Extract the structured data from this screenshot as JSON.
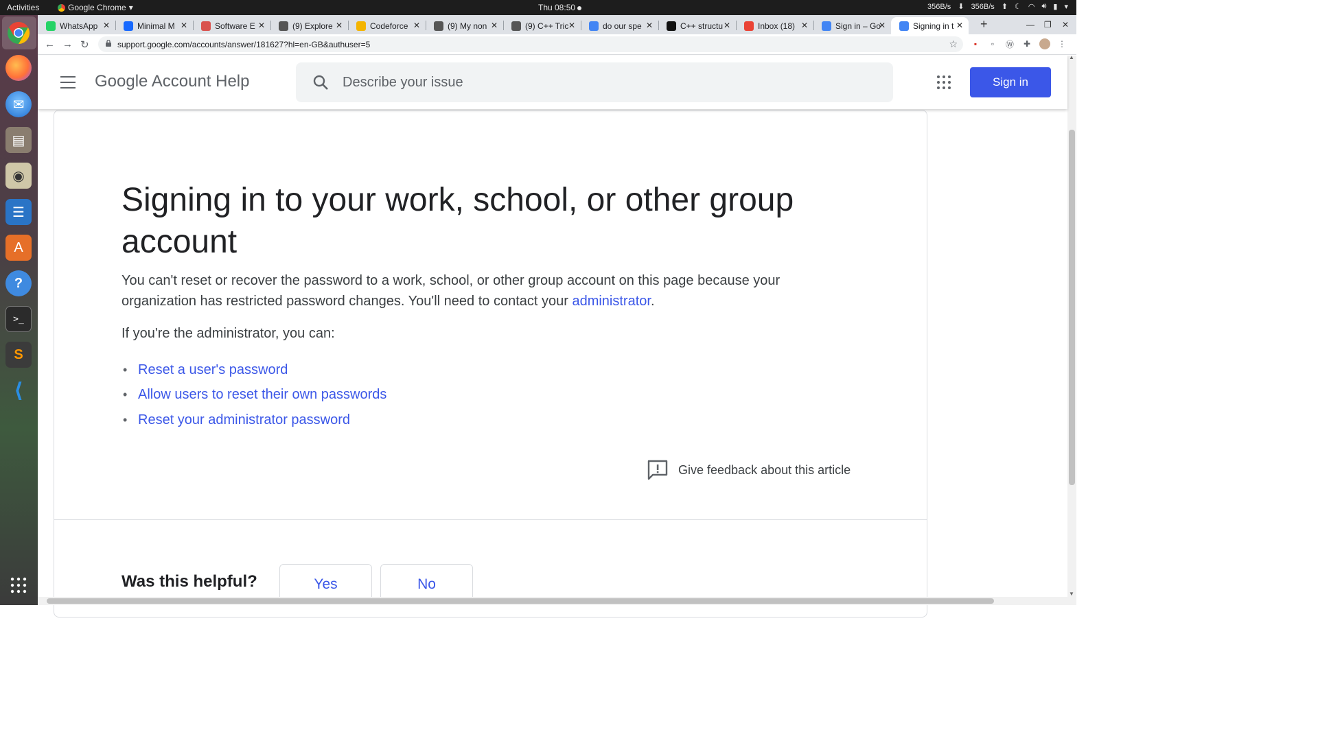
{
  "system": {
    "activities": "Activities",
    "app_name": "Google Chrome",
    "clock": "Thu 08:50",
    "net_down": "356B/s",
    "net_up": "356B/s"
  },
  "browser": {
    "tabs": [
      {
        "title": "WhatsApp",
        "favicon": "whatsapp-icon",
        "color": "#25d366"
      },
      {
        "title": "Minimal M",
        "favicon": "behance-icon",
        "color": "#1769ff"
      },
      {
        "title": "Software E",
        "favicon": "site-icon",
        "color": "#d9534f"
      },
      {
        "title": "(9) Explore",
        "favicon": "quora-icon",
        "color": "#555555"
      },
      {
        "title": "Codeforce",
        "favicon": "codeforces-icon",
        "color": "#f4b400"
      },
      {
        "title": "(9) My non",
        "favicon": "quora-icon",
        "color": "#555555"
      },
      {
        "title": "(9) C++ Tric",
        "favicon": "quora-icon",
        "color": "#555555"
      },
      {
        "title": "do our spe",
        "favicon": "google-icon",
        "color": "#4285f4"
      },
      {
        "title": "C++ structu",
        "favicon": "site-icon",
        "color": "#111111"
      },
      {
        "title": "Inbox (18)",
        "favicon": "gmail-icon",
        "color": "#ea4335"
      },
      {
        "title": "Sign in – Go",
        "favicon": "google-icon",
        "color": "#4285f4"
      },
      {
        "title": "Signing in t",
        "favicon": "google-icon",
        "color": "#4285f4",
        "active": true
      }
    ],
    "new_tab": "+",
    "url": "support.google.com/accounts/answer/181627?hl=en-GB&authuser=5"
  },
  "header": {
    "title": "Google Account Help",
    "search_placeholder": "Describe your issue",
    "signin_label": "Sign in"
  },
  "article": {
    "title": "Signing in to your work, school, or other group account",
    "intro": "You can't reset or recover the password to a work, school, or other group account on this page because your organization has restricted password changes. You'll need to contact your ",
    "intro_link": "administrator",
    "intro_end": ".",
    "admin_line": "If you're the administrator, you can:",
    "links": [
      "Reset a user's password",
      "Allow users to reset their own passwords",
      "Reset your administrator password"
    ],
    "feedback": "Give feedback about this article"
  },
  "helpful": {
    "question": "Was this helpful?",
    "yes": "Yes",
    "no": "No"
  },
  "colors": {
    "accent": "#3b57e8",
    "text": "#202124",
    "secondary": "#5f6368"
  }
}
